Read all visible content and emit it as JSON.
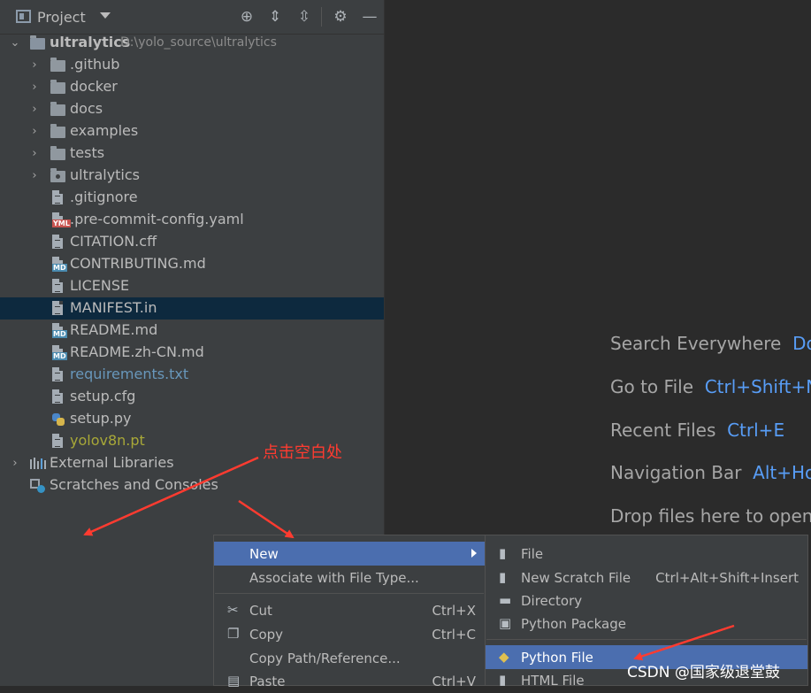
{
  "toolbar": {
    "title": "Project",
    "icons": [
      "locate-icon",
      "expand-all-icon",
      "collapse-all-icon",
      "gear-icon",
      "minimize-icon"
    ]
  },
  "tree": {
    "root_name": "ultralytics",
    "root_path": "D:\\yolo_source\\ultralytics",
    "folders": [
      ".github",
      "docker",
      "docs",
      "examples",
      "tests",
      "ultralytics"
    ],
    "files": [
      {
        "name": ".gitignore",
        "type": "ignore"
      },
      {
        "name": ".pre-commit-config.yaml",
        "type": "yml"
      },
      {
        "name": "CITATION.cff",
        "type": "text"
      },
      {
        "name": "CONTRIBUTING.md",
        "type": "md"
      },
      {
        "name": "LICENSE",
        "type": "text"
      },
      {
        "name": "MANIFEST.in",
        "type": "text"
      },
      {
        "name": "README.md",
        "type": "md"
      },
      {
        "name": "README.zh-CN.md",
        "type": "md"
      },
      {
        "name": "requirements.txt",
        "type": "text"
      },
      {
        "name": "setup.cfg",
        "type": "text"
      },
      {
        "name": "setup.py",
        "type": "python"
      },
      {
        "name": "yolov8n.pt",
        "type": "unknown"
      }
    ],
    "external_libraries": "External Libraries",
    "scratches": "Scratches and Consoles",
    "colors": {
      "modified": "#6897bb",
      "unversioned": "#a8a838",
      "selection": "#0d293e"
    }
  },
  "editor_hints": [
    {
      "label": "Search Everywhere",
      "key": "Dou"
    },
    {
      "label": "Go to File",
      "key": "Ctrl+Shift+N"
    },
    {
      "label": "Recent Files",
      "key": "Ctrl+E"
    },
    {
      "label": "Navigation Bar",
      "key": "Alt+Hor"
    },
    {
      "label": "Drop files here to open f",
      "key": ""
    }
  ],
  "annotation": "点击空白处",
  "context_menu": {
    "items": [
      {
        "label": "New",
        "shortcut": ""
      },
      {
        "label": "Associate with File Type...",
        "shortcut": ""
      },
      {
        "label": "Cut",
        "shortcut": "Ctrl+X"
      },
      {
        "label": "Copy",
        "shortcut": "Ctrl+C"
      },
      {
        "label": "Copy Path/Reference...",
        "shortcut": ""
      },
      {
        "label": "Paste",
        "shortcut": "Ctrl+V"
      }
    ]
  },
  "submenu": {
    "items": [
      {
        "label": "File",
        "shortcut": ""
      },
      {
        "label": "New Scratch File",
        "shortcut": "Ctrl+Alt+Shift+Insert"
      },
      {
        "label": "Directory",
        "shortcut": ""
      },
      {
        "label": "Python Package",
        "shortcut": ""
      },
      {
        "label": "Python File",
        "shortcut": ""
      },
      {
        "label": "HTML File",
        "shortcut": ""
      }
    ]
  },
  "watermark": "CSDN @国家级退堂鼓",
  "colors": {
    "highlight": "#4b6eaf",
    "accent_key": "#589df6",
    "annotation": "#ff3b30"
  }
}
